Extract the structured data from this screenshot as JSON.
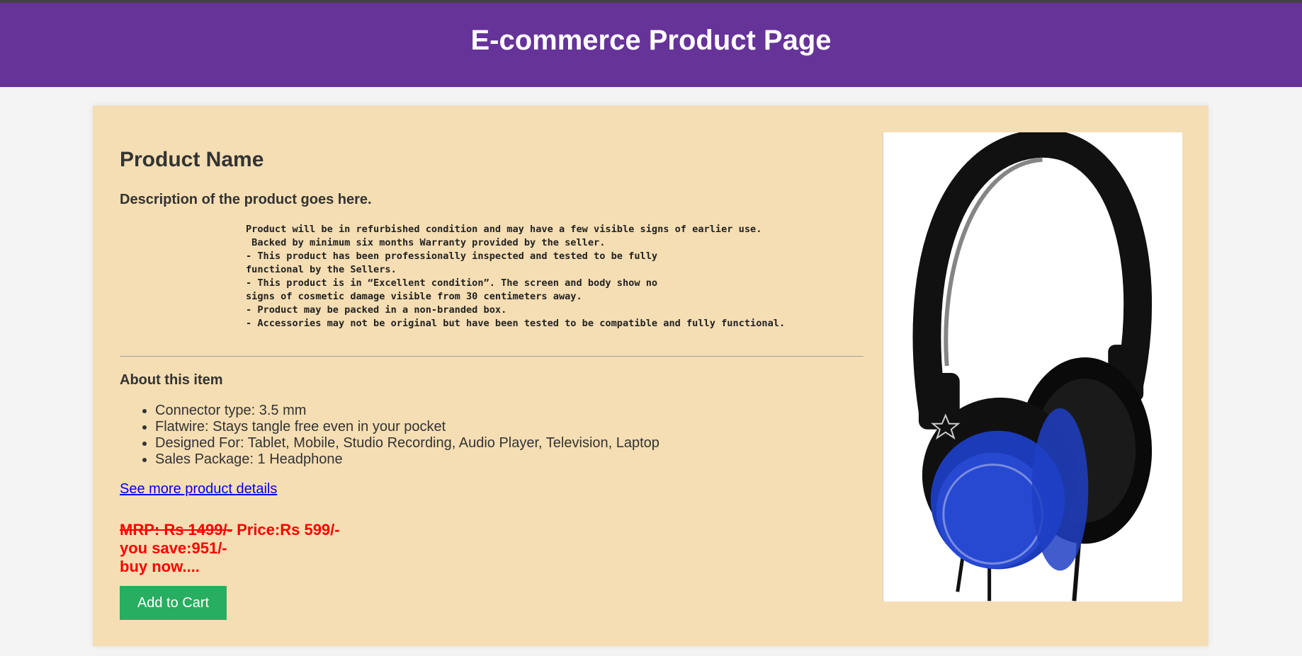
{
  "header": {
    "title": "E-commerce Product Page"
  },
  "product": {
    "name": "Product Name",
    "description_heading": "Description of the product goes here.",
    "description_text": "Product will be in refurbished condition and may have a few visible signs of earlier use.\n Backed by minimum six months Warranty provided by the seller.\n- This product has been professionally inspected and tested to be fully\nfunctional by the Sellers.\n- This product is in “Excellent condition”. The screen and body show no\nsigns of cosmetic damage visible from 30 centimeters away.\n- Product may be packed in a non-branded box.\n- Accessories may not be original but have been tested to be compatible and fully functional.",
    "image_alt": "Blue and black over-ear headphones"
  },
  "about": {
    "heading": "About this item",
    "items": [
      "Connector type: 3.5 mm",
      "Flatwire: Stays tangle free even in your pocket",
      "Designed For: Tablet, Mobile, Studio Recording, Audio Player, Television, Laptop",
      "Sales Package: 1 Headphone"
    ]
  },
  "links": {
    "see_more": "See more product details"
  },
  "pricing": {
    "mrp": "MRP: Rs 1499/-",
    "price": "Price:Rs 599/-",
    "savings": "you save:951/-",
    "cta_text": "buy now...."
  },
  "actions": {
    "add_to_cart": "Add to Cart"
  },
  "colors": {
    "header_bg": "#663399",
    "card_bg": "#f5deb3",
    "price_red": "#ff0000",
    "cart_green": "#27ae60",
    "link_blue": "#0000ee"
  }
}
